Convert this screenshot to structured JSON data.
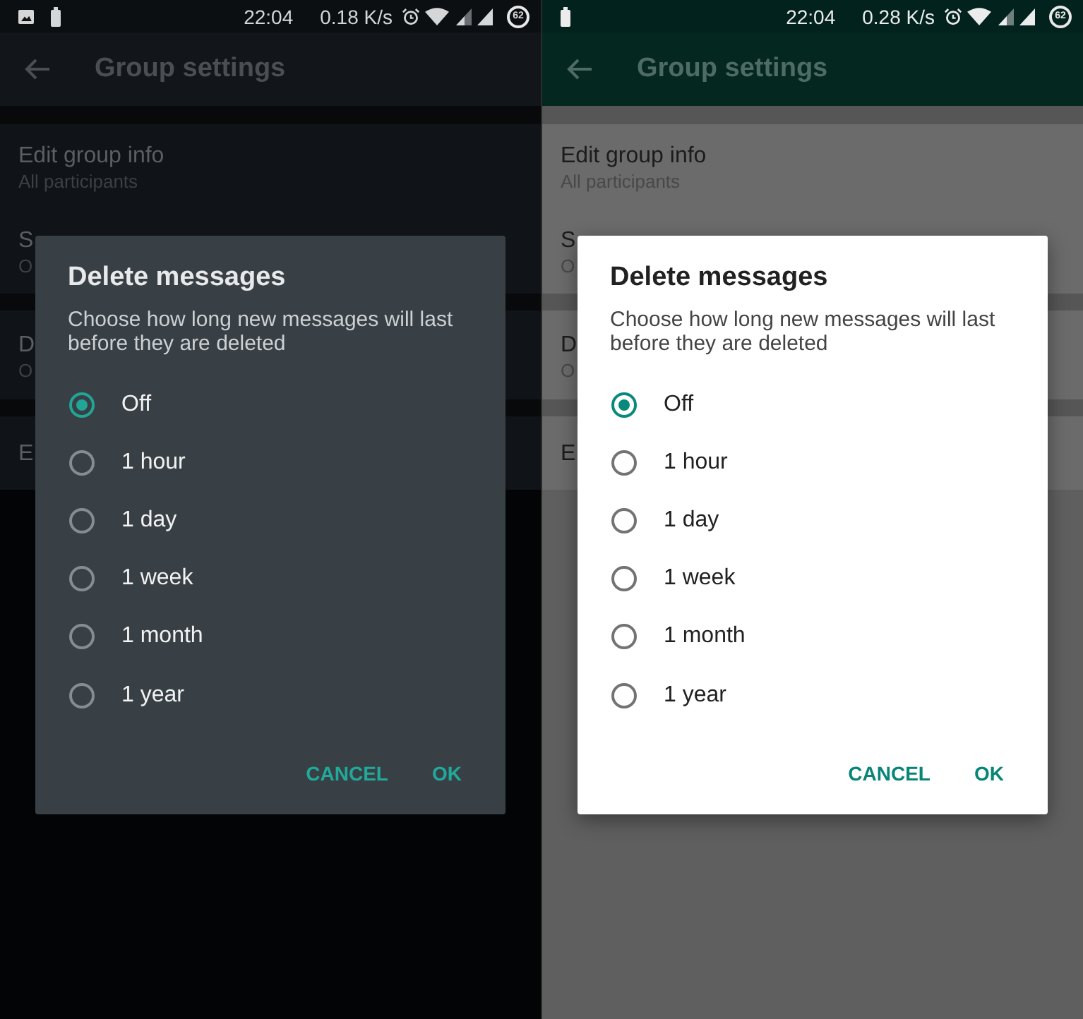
{
  "screens": [
    {
      "dark_theme": true,
      "status_bar": {
        "notifications": [
          {
            "kind": "image"
          },
          {
            "kind": "battery"
          }
        ],
        "time": "22:04",
        "speed": "0.18 K/s",
        "battery": "62"
      },
      "app_bar": {
        "title": "Group settings"
      },
      "settings": [
        {
          "items": [
            {
              "title": "Edit group info",
              "subtitle": "All participants"
            },
            {
              "title": "S",
              "subtitle": "O"
            }
          ]
        },
        {
          "items": [
            {
              "title": "D",
              "subtitle": "O"
            }
          ]
        },
        {
          "items": [
            {
              "title": "E"
            }
          ]
        }
      ],
      "dialog": {
        "title": "Delete messages",
        "description": "Choose how long new messages will last before they are deleted",
        "options": [
          {
            "label": "Off",
            "selected": true
          },
          {
            "label": "1 hour",
            "selected": false
          },
          {
            "label": "1 day",
            "selected": false
          },
          {
            "label": "1 week",
            "selected": false
          },
          {
            "label": "1 month",
            "selected": false
          },
          {
            "label": "1 year",
            "selected": false
          }
        ],
        "buttons": [
          {
            "label": "CANCEL"
          },
          {
            "label": "OK"
          }
        ]
      }
    },
    {
      "dark_theme": false,
      "status_bar": {
        "notifications": [
          {
            "kind": "battery"
          }
        ],
        "time": "22:04",
        "speed": "0.28 K/s",
        "battery": "62"
      },
      "app_bar": {
        "title": "Group settings"
      },
      "settings": [
        {
          "items": [
            {
              "title": "Edit group info",
              "subtitle": "All participants"
            },
            {
              "title": "S",
              "subtitle": "O"
            }
          ]
        },
        {
          "items": [
            {
              "title": "D",
              "subtitle": "O"
            }
          ]
        },
        {
          "items": [
            {
              "title": "E"
            }
          ]
        }
      ],
      "dialog": {
        "title": "Delete messages",
        "description": "Choose how long new messages will last before they are deleted",
        "options": [
          {
            "label": "Off",
            "selected": true
          },
          {
            "label": "1 hour",
            "selected": false
          },
          {
            "label": "1 day",
            "selected": false
          },
          {
            "label": "1 week",
            "selected": false
          },
          {
            "label": "1 month",
            "selected": false
          },
          {
            "label": "1 year",
            "selected": false
          }
        ],
        "buttons": [
          {
            "label": "CANCEL"
          },
          {
            "label": "OK"
          }
        ]
      }
    }
  ]
}
